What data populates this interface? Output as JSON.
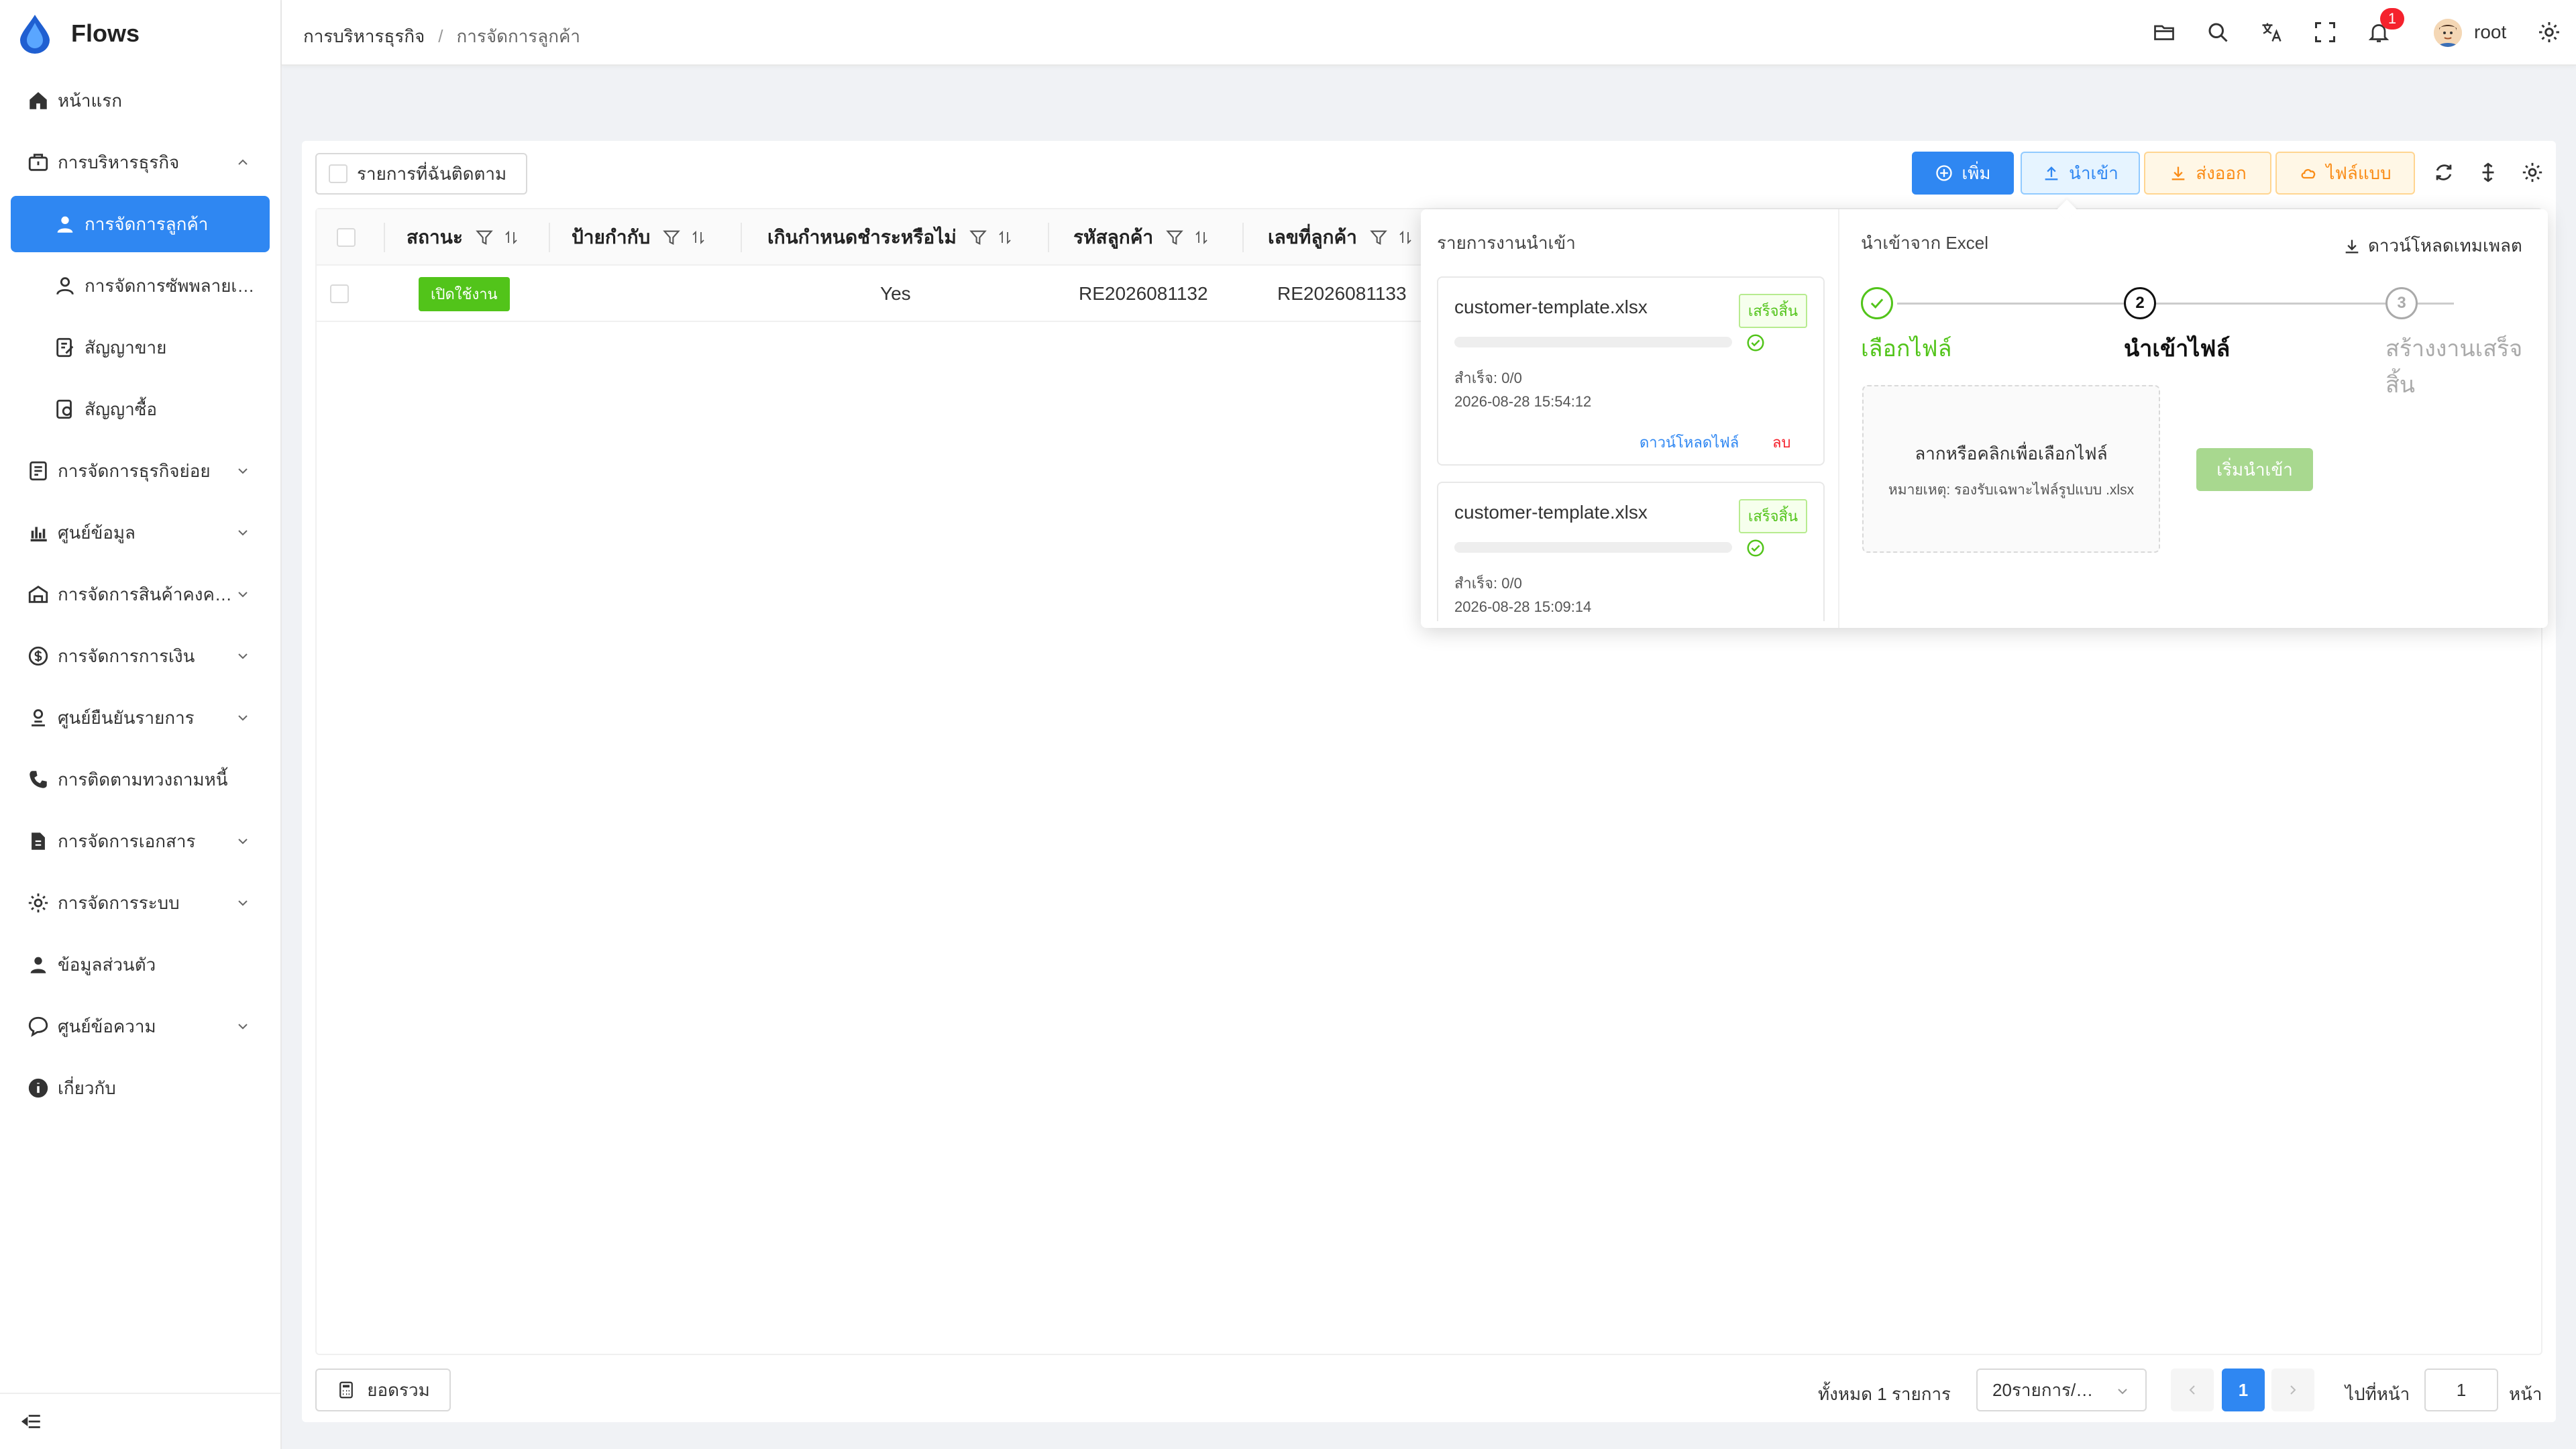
{
  "app": {
    "name": "Flows"
  },
  "colors": {
    "primary": "#2f87f2",
    "success": "#52c41a",
    "warning": "#fa8c16",
    "danger": "#f5222d"
  },
  "sidebar": {
    "items": [
      {
        "label": "หน้าแรก",
        "icon": "home-icon"
      },
      {
        "label": "การบริหารธุรกิจ",
        "icon": "briefcase-icon",
        "expanded": true
      },
      {
        "label": "การจัดการลูกค้า",
        "icon": "user-icon",
        "active": true
      },
      {
        "label": "การจัดการซัพพลายเออร์",
        "icon": "user-outline-icon"
      },
      {
        "label": "สัญญาขาย",
        "icon": "contract-icon"
      },
      {
        "label": "สัญญาซื้อ",
        "icon": "purchase-contract-icon"
      },
      {
        "label": "การจัดการธุรกิจย่อย",
        "icon": "document-icon"
      },
      {
        "label": "ศูนย์ข้อมูล",
        "icon": "bar-chart-icon"
      },
      {
        "label": "การจัดการสินค้าคงคลัง",
        "icon": "warehouse-icon"
      },
      {
        "label": "การจัดการการเงิน",
        "icon": "dollar-icon"
      },
      {
        "label": "ศูนย์ยืนยันรายการ",
        "icon": "approval-icon"
      },
      {
        "label": "การติดตามทวงถามหนี้",
        "icon": "phone-icon"
      },
      {
        "label": "การจัดการเอกสาร",
        "icon": "file-icon"
      },
      {
        "label": "การจัดการระบบ",
        "icon": "gear-icon"
      },
      {
        "label": "ข้อมูลส่วนตัว",
        "icon": "profile-icon"
      },
      {
        "label": "ศูนย์ข้อความ",
        "icon": "message-icon"
      },
      {
        "label": "เกี่ยวกับ",
        "icon": "info-icon"
      }
    ]
  },
  "header": {
    "breadcrumb": [
      "การบริหารธุรกิจ",
      "การจัดการลูกค้า"
    ],
    "breadcrumb_separator": "/",
    "notification_count": "1",
    "user": "root"
  },
  "toolbar": {
    "follow_label": "รายการที่ฉันติดตาม",
    "add_label": "เพิ่ม",
    "import_label": "นำเข้า",
    "export_label": "ส่งออก",
    "template_label": "ไฟล์แบบ"
  },
  "table": {
    "columns": [
      "สถานะ",
      "ป้ายกำกับ",
      "เกินกำหนดชำระหรือไม่",
      "รหัสลูกค้า",
      "เลขที่ลูกค้า"
    ],
    "rows": [
      {
        "status": "เปิดใช้งาน",
        "tag": "",
        "overdue": "Yes",
        "customer_code": "RE2026081132",
        "customer_no": "RE2026081133"
      }
    ]
  },
  "footer": {
    "summary_label": "ยอดรวม",
    "total_text": "ทั้งหมด 1 รายการ",
    "page_size": "20รายการ/…",
    "current_page": "1",
    "goto_label": "ไปที่หน้า",
    "goto_value": "1",
    "goto_suffix": "หน้า"
  },
  "import_panel": {
    "jobs_title": "รายการงานนำเข้า",
    "excel_title": "นำเข้าจาก Excel",
    "download_template": "ดาวน์โหลดเทมเพลต",
    "jobs": [
      {
        "file": "customer-template.xlsx",
        "status": "เสร็จสิ้น",
        "progress": 1.0,
        "success": "สำเร็จ: 0/0",
        "time": "2026-08-28 15:54:12",
        "download": "ดาวน์โหลดไฟล์",
        "delete": "ลบ"
      },
      {
        "file": "customer-template.xlsx",
        "status": "เสร็จสิ้น",
        "progress": 1.0,
        "success": "สำเร็จ: 0/0",
        "time": "2026-08-28 15:09:14"
      }
    ],
    "steps": [
      {
        "num": "1",
        "label": "เลือกไฟล์",
        "state": "done"
      },
      {
        "num": "2",
        "label": "นำเข้าไฟล์",
        "state": "current"
      },
      {
        "num": "3",
        "label": "สร้างงานเสร็จสิ้น",
        "state": "pending"
      }
    ],
    "dropzone_text": "ลากหรือคลิกเพื่อเลือกไฟล์",
    "dropzone_note": "หมายเหตุ: รองรับเฉพาะไฟล์รูปแบบ .xlsx",
    "start_label": "เริ่มนำเข้า"
  }
}
